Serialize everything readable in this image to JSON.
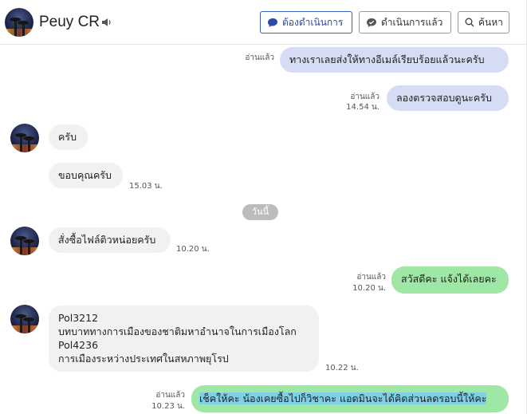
{
  "header": {
    "contact_name": "Peuy CR",
    "buttons": {
      "todo": "ต้องดำเนินการ",
      "done": "ดำเนินการแล้ว",
      "search": "ค้นหา"
    }
  },
  "messages": [
    {
      "dir": "out",
      "style": "blue",
      "text": "ทางเราเลยส่งให้ทางอีเมล์เรียบร้อยแล้วนะครับ",
      "read": "อ่านแล้ว",
      "time": ""
    },
    {
      "dir": "out",
      "style": "blue",
      "text": "ลองตรวจสอบดูนะครับ",
      "read": "อ่านแล้ว",
      "time": "14.54 น."
    },
    {
      "dir": "in",
      "text": "ครับ",
      "time": ""
    },
    {
      "dir": "in",
      "text": "ขอบคุณครับ",
      "time": "15.03 น."
    },
    {
      "dir": "in",
      "text": "สั่งซื้อไฟล์ติวหน่อยครับ",
      "time": "10.20 น."
    },
    {
      "dir": "out",
      "style": "green",
      "text": "สวัสดีคะ แจ้งได้เลยคะ",
      "read": "อ่านแล้ว",
      "time": "10.20 น."
    },
    {
      "dir": "in",
      "lines": [
        "Pol3212",
        "บทบาททางการเมืองของชาติมหาอำนาจในการเมืองโลก",
        "Pol4236",
        "การเมืองระหว่างประเทศในสหภาพยุโรป"
      ],
      "time": "10.22 น."
    },
    {
      "dir": "out",
      "style": "green",
      "text": "เช็คให้คะ น้องเคยซื้อไปก็วิชาคะ แอดมินจะได้คิดส่วนลดรอบนี้ให้คะ",
      "read": "อ่านแล้ว",
      "time": "10.23 น."
    }
  ],
  "day_separator": "วันนี้",
  "colors": {
    "accent": "#3b5fbf",
    "out_blue": "#d6dcf3",
    "out_green": "#9ee7a4",
    "incoming": "#f1f1f2"
  },
  "icons": [
    "speaker-icon",
    "chat-bubble-icon",
    "chat-check-icon",
    "search-icon"
  ]
}
